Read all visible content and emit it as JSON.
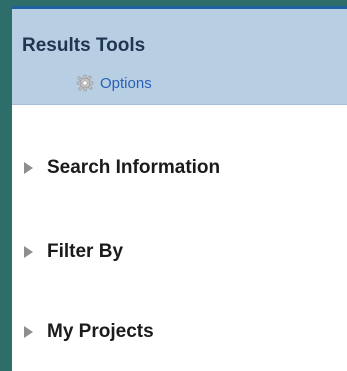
{
  "header": {
    "title": "Results Tools",
    "options_label": "Options",
    "options_icon": "gear-icon"
  },
  "sections": [
    {
      "label": "Search Information",
      "icon": "triangle-right-icon"
    },
    {
      "label": "Filter By",
      "icon": "triangle-right-icon"
    },
    {
      "label": "My Projects",
      "icon": "triangle-right-icon"
    }
  ],
  "colors": {
    "background": "#2e6e6a",
    "header_bg": "#b8cfe3",
    "top_border": "#1f5fa3",
    "link": "#2a60b6",
    "arrow": "#8e8e8e"
  }
}
